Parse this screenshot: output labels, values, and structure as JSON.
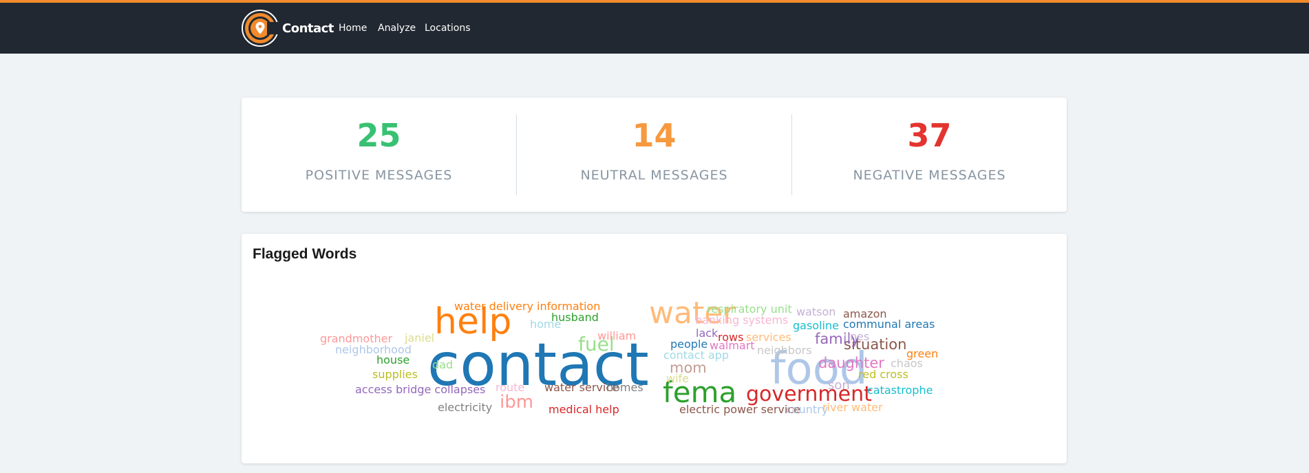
{
  "brand": {
    "name": "Contact",
    "accent_color": "#f08a2c"
  },
  "nav": {
    "links": [
      "Home",
      "Analyze",
      "Locations"
    ]
  },
  "stats": [
    {
      "value": "25",
      "label": "POSITIVE MESSAGES",
      "color": "#38c172"
    },
    {
      "value": "14",
      "label": "NEUTRAL MESSAGES",
      "color": "#f6993f"
    },
    {
      "value": "37",
      "label": "NEGATIVE MESSAGES",
      "color": "#e3342f"
    }
  ],
  "flagged_words": {
    "title": "Flagged Words",
    "words": [
      {
        "text": "contact",
        "color": "#1f77b4"
      },
      {
        "text": "food",
        "color": "#aec7e8"
      },
      {
        "text": "help",
        "color": "#ff7f0e"
      },
      {
        "text": "water",
        "color": "#ffbb78"
      },
      {
        "text": "fema",
        "color": "#2ca02c"
      },
      {
        "text": "government",
        "color": "#d62728"
      },
      {
        "text": "fuel",
        "color": "#98df8a"
      },
      {
        "text": "ibm",
        "color": "#ff9896"
      },
      {
        "text": "situation",
        "color": "#8c564b"
      },
      {
        "text": "daughter",
        "color": "#e377c2"
      },
      {
        "text": "family",
        "color": "#9467bd"
      },
      {
        "text": "mom",
        "color": "#c49c94"
      },
      {
        "text": "son",
        "color": "#c5b0d5"
      },
      {
        "text": "water delivery information",
        "color": "#ff7f0e"
      },
      {
        "text": "husband",
        "color": "#2ca02c"
      },
      {
        "text": "respiratory unit",
        "color": "#98df8a"
      },
      {
        "text": "watson",
        "color": "#c5b0d5"
      },
      {
        "text": "amazon",
        "color": "#8c564b"
      },
      {
        "text": "communal areas",
        "color": "#1f77b4"
      },
      {
        "text": "banking systems",
        "color": "#f7b6d2"
      },
      {
        "text": "gasoline",
        "color": "#17becf"
      },
      {
        "text": "home",
        "color": "#9edae5"
      },
      {
        "text": "lack",
        "color": "#9467bd"
      },
      {
        "text": "lines",
        "color": "#c5b0d5"
      },
      {
        "text": "grandmother",
        "color": "#ff9896"
      },
      {
        "text": "janiel",
        "color": "#dbdb8d"
      },
      {
        "text": "william",
        "color": "#ff9896"
      },
      {
        "text": "rows",
        "color": "#d62728"
      },
      {
        "text": "services",
        "color": "#ffbb78"
      },
      {
        "text": "people",
        "color": "#1f77b4"
      },
      {
        "text": "neighborhood",
        "color": "#aec7e8"
      },
      {
        "text": "walmart",
        "color": "#e377c2"
      },
      {
        "text": "green",
        "color": "#ff7f0e"
      },
      {
        "text": "house",
        "color": "#2ca02c"
      },
      {
        "text": "contact app",
        "color": "#9edae5"
      },
      {
        "text": "neighbors",
        "color": "#c7c7c7"
      },
      {
        "text": "chaos",
        "color": "#c7c7c7"
      },
      {
        "text": "dad",
        "color": "#98df8a"
      },
      {
        "text": "supplies",
        "color": "#bcbd22"
      },
      {
        "text": "red cross",
        "color": "#bcbd22"
      },
      {
        "text": "wife",
        "color": "#dbdb8d"
      },
      {
        "text": "route",
        "color": "#f7b6d2"
      },
      {
        "text": "access bridge collapses",
        "color": "#9467bd"
      },
      {
        "text": "water service",
        "color": "#8c564b"
      },
      {
        "text": "homes",
        "color": "#7f7f7f"
      },
      {
        "text": "catastrophe",
        "color": "#17becf"
      },
      {
        "text": "electricity",
        "color": "#7f7f7f"
      },
      {
        "text": "medical help",
        "color": "#d62728"
      },
      {
        "text": "electric power service",
        "color": "#8c564b"
      },
      {
        "text": "country",
        "color": "#aec7e8"
      },
      {
        "text": "river water",
        "color": "#ffbb78"
      }
    ]
  }
}
